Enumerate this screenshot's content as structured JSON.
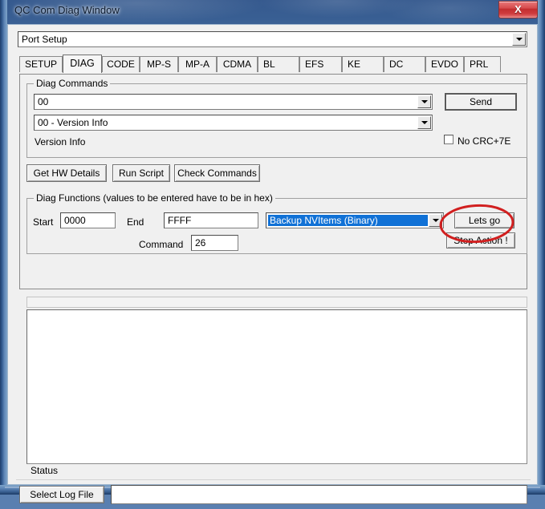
{
  "window": {
    "title": "QC Com Diag Window",
    "close_label": "X"
  },
  "port_combo": {
    "value": "Port Setup"
  },
  "tabs": [
    {
      "label": "SETUP",
      "active": false
    },
    {
      "label": "DIAG",
      "active": true
    },
    {
      "label": "CODE",
      "active": false
    },
    {
      "label": "MP-S",
      "active": false
    },
    {
      "label": "MP-A",
      "active": false
    },
    {
      "label": "CDMA",
      "active": false
    },
    {
      "label": "BL",
      "active": false
    },
    {
      "label": "EFS",
      "active": false
    },
    {
      "label": "KE",
      "active": false
    },
    {
      "label": "DC",
      "active": false
    },
    {
      "label": "EVDO",
      "active": false
    },
    {
      "label": "PRL",
      "active": false
    }
  ],
  "diag_commands": {
    "group_label": "Diag Commands",
    "command_combo_value": "00",
    "description_combo_value": "00 - Version Info",
    "info_label": "Version Info",
    "send_label": "Send",
    "no_crc_label": "No CRC+7E",
    "no_crc_checked": false
  },
  "action_buttons": {
    "get_hw_details": "Get HW Details",
    "run_script": "Run Script",
    "check_commands": "Check Commands"
  },
  "diag_functions": {
    "group_label": "Diag Functions (values to be entered have to be in hex)",
    "start_label": "Start",
    "start_value": "0000",
    "end_label": "End",
    "end_value": "FFFF",
    "command_label": "Command",
    "command_value": "26",
    "function_combo_value": "Backup NVItems (Binary)",
    "lets_go_label": "Lets go",
    "stop_action_label": "Stop Action !"
  },
  "output": {
    "text": ""
  },
  "status": {
    "label": "Status"
  },
  "log": {
    "select_log_file_label": "Select Log File",
    "log_path_value": ""
  },
  "annotation": {
    "shape": "ellipse",
    "color": "#d11f1f",
    "targets": "lets-go-button"
  }
}
